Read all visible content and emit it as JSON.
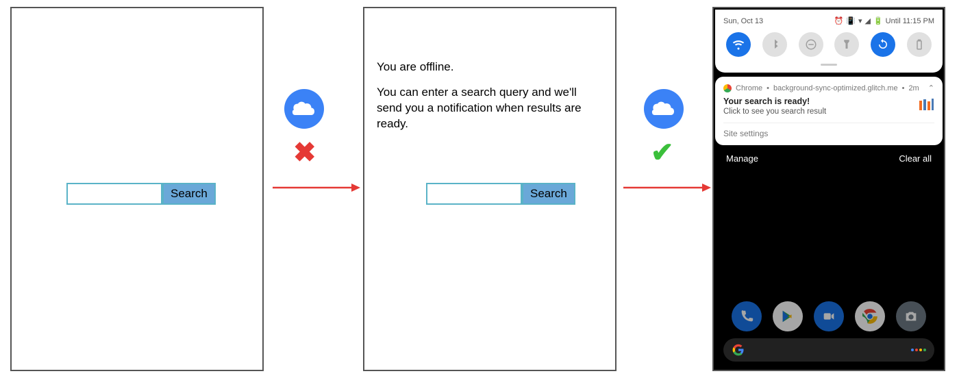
{
  "panel1": {
    "search_button": "Search",
    "search_value": ""
  },
  "panel2": {
    "offline_title": "You are offline.",
    "offline_body": "You can enter a search query and we'll send you a notification when results are ready.",
    "search_button": "Search",
    "search_value": ""
  },
  "transition1": {
    "icon": "cloud",
    "status": "fail"
  },
  "transition2": {
    "icon": "cloud",
    "status": "success"
  },
  "panel3": {
    "status_bar": {
      "date": "Sun, Oct 13",
      "until": "Until 11:15 PM"
    },
    "toggles": [
      {
        "name": "wifi",
        "on": true
      },
      {
        "name": "bluetooth",
        "on": false
      },
      {
        "name": "dnd",
        "on": false
      },
      {
        "name": "flashlight",
        "on": false
      },
      {
        "name": "autorotate",
        "on": true
      },
      {
        "name": "battery",
        "on": false
      }
    ],
    "notification": {
      "app": "Chrome",
      "source": "background-sync-optimized.glitch.me",
      "age": "2m",
      "title": "Your search is ready!",
      "subtitle": "Click to see you search result",
      "action": "Site settings"
    },
    "shade": {
      "manage": "Manage",
      "clear": "Clear all"
    },
    "dock": [
      "phone",
      "play",
      "duo",
      "chrome",
      "camera"
    ]
  }
}
